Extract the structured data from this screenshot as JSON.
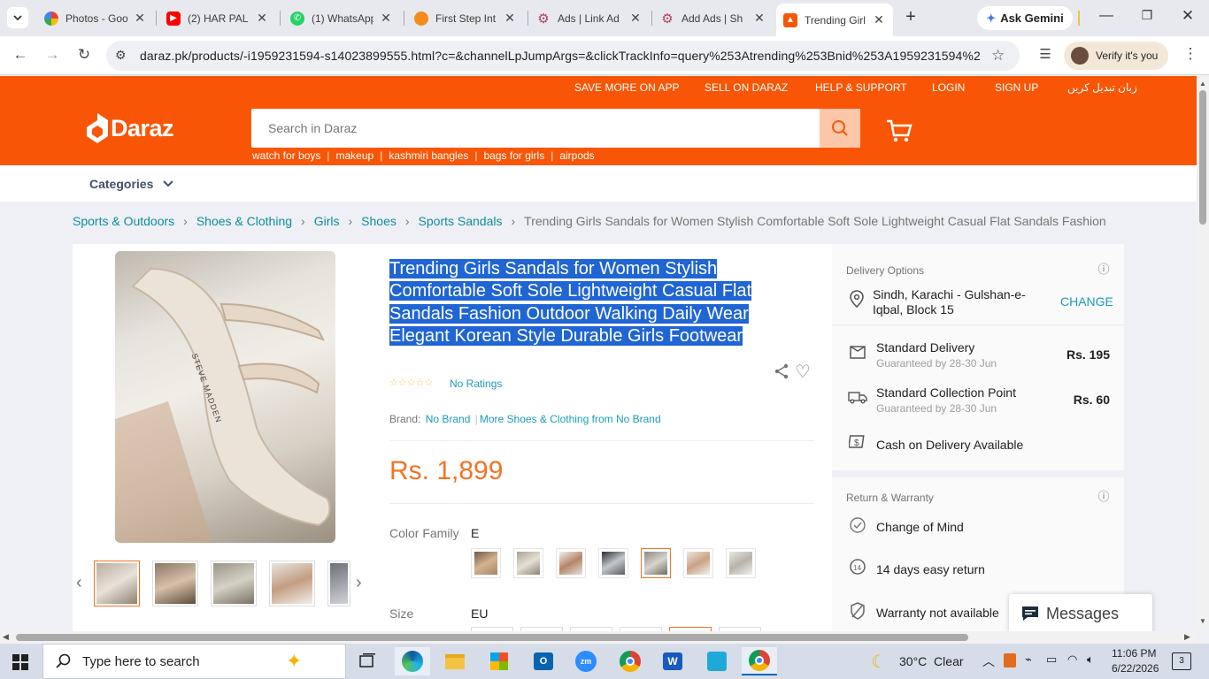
{
  "browser": {
    "tabs": [
      {
        "title": "Photos - Goo",
        "icon": "google-photos-icon"
      },
      {
        "title": "(2) HAR PAL",
        "icon": "youtube-icon"
      },
      {
        "title": "(1) WhatsApp",
        "icon": "whatsapp-icon"
      },
      {
        "title": "First Step Int",
        "icon": "firststep-icon"
      },
      {
        "title": "Ads | Link Ad",
        "icon": "gear-icon"
      },
      {
        "title": "Add Ads | Sh",
        "icon": "gear-icon"
      },
      {
        "title": "Trending Girl",
        "icon": "daraz-icon"
      }
    ],
    "new_tab": "+",
    "gemini_label": "Ask Gemini",
    "url": "daraz.pk/products/-i1959231594-s14023899555.html?c=&channelLpJumpArgs=&clickTrackInfo=query%253Atrending%253Bnid%253A1959231594%25...",
    "verify_label": "Verify it's you"
  },
  "header": {
    "top_links": [
      "SAVE MORE ON APP",
      "SELL ON DARAZ",
      "HELP & SUPPORT",
      "LOGIN",
      "SIGN UP",
      "زبان تبدیل کریں"
    ],
    "logo_text": "Daraz",
    "search_placeholder": "Search in Daraz",
    "hot_keywords": [
      "watch for boys",
      "makeup",
      "kashmiri bangles",
      "bags for girls",
      "airpods"
    ],
    "categories_label": "Categories"
  },
  "breadcrumb": {
    "items": [
      "Sports & Outdoors",
      "Shoes & Clothing",
      "Girls",
      "Shoes",
      "Sports Sandals"
    ],
    "current": "Trending Girls Sandals for Women Stylish Comfortable Soft Sole Lightweight Casual Flat Sandals Fashion"
  },
  "product": {
    "title": "Trending Girls Sandals for Women Stylish Comfortable Soft Sole Lightweight Casual Flat Sandals Fashion Outdoor Walking Daily Wear Elegant Korean Style Durable Girls Footwear",
    "ratings_text": "No Ratings",
    "rating_stars": 0,
    "brand_label": "Brand:",
    "brand_value": "No Brand",
    "more_from": "More Shoes & Clothing from No Brand",
    "price": "Rs. 1,899",
    "color_family_label": "Color Family",
    "color_family_value": "E",
    "size_label": "Size",
    "size_value": "EU",
    "main_image_text": "STEVE MADDEN"
  },
  "delivery": {
    "section_title": "Delivery Options",
    "location": "Sindh, Karachi - Gulshan-e-Iqbal, Block 15",
    "change_label": "CHANGE",
    "standard_title": "Standard Delivery",
    "standard_sub": "Guaranteed by 28-30 Jun",
    "standard_price": "Rs. 195",
    "collection_title": "Standard Collection Point",
    "collection_sub": "Guaranteed by 28-30 Jun",
    "collection_price": "Rs. 60",
    "cod": "Cash on Delivery Available",
    "return_title": "Return & Warranty",
    "change_of_mind": "Change of Mind",
    "easy_return": "14 days easy return",
    "warranty": "Warranty not available",
    "messages_label": "Messages"
  },
  "taskbar": {
    "search_placeholder": "Type here to search",
    "weather": "30°C  Clear",
    "time": "11:06 PM",
    "date": "6/22/2026",
    "notification_count": "3"
  },
  "colors": {
    "brand": "#f85606",
    "price": "#f57224",
    "link": "#1a9cb7",
    "selection": "#1f65d4"
  }
}
